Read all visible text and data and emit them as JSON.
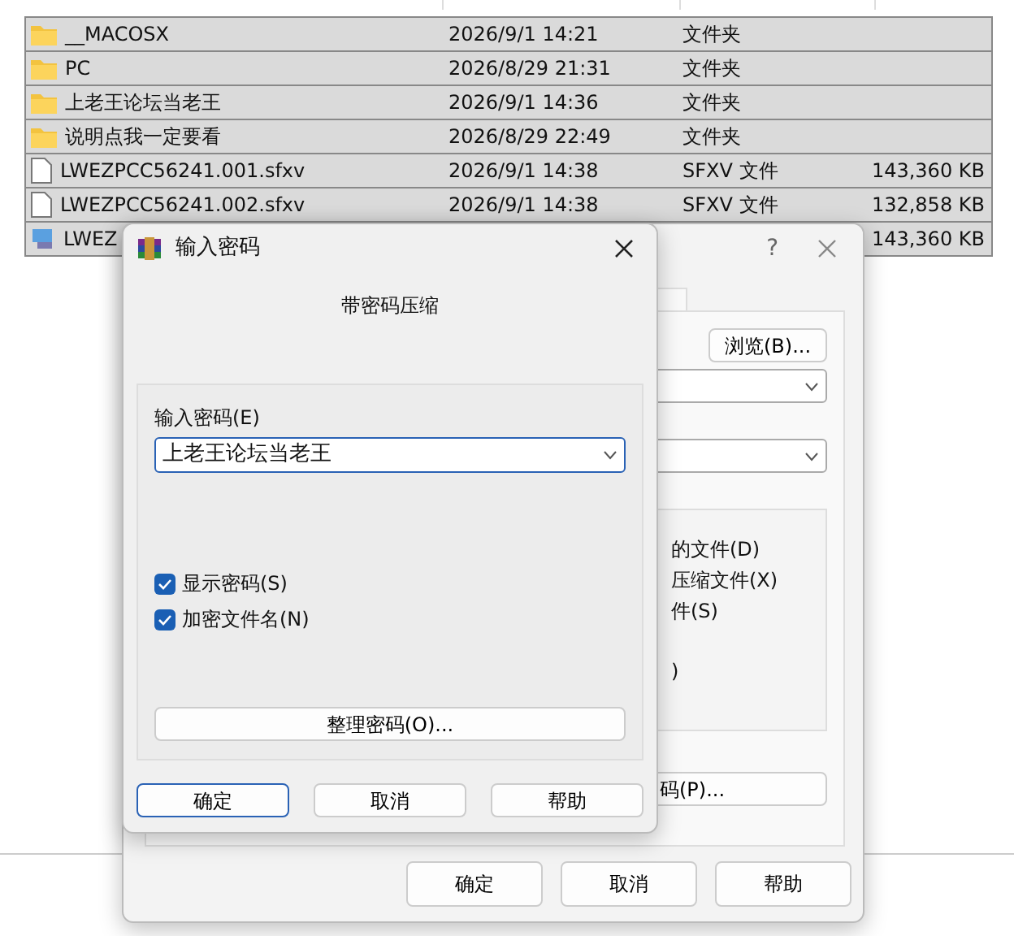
{
  "file_list": {
    "rows": [
      {
        "kind": "folder",
        "selected": true,
        "name": "__MACOSX",
        "modified": "2026/9/1 14:21",
        "type": "文件夹"
      },
      {
        "kind": "folder",
        "selected": true,
        "name": "PC",
        "modified": "2026/8/29 21:31",
        "type": "文件夹"
      },
      {
        "kind": "folder",
        "selected": true,
        "name": "上老王论坛当老王",
        "modified": "2026/9/1 14:36",
        "type": "文件夹"
      },
      {
        "kind": "folder",
        "selected": true,
        "name": "说明点我一定要看",
        "modified": "2026/8/29 22:49",
        "type": "文件夹"
      },
      {
        "kind": "file",
        "selected": true,
        "name": "LWEZPCC56241.001.sfxv",
        "modified": "2026/9/1 14:38",
        "type": "SFXV 文件",
        "size": "143,360 KB"
      },
      {
        "kind": "file",
        "selected": true,
        "name": "LWEZPCC56241.002.sfxv",
        "modified": "2026/9/1 14:38",
        "type": "SFXV 文件",
        "size": "132,858 KB"
      },
      {
        "kind": "app",
        "selected": true,
        "name": "LWEZ",
        "size": "143,360 KB"
      }
    ]
  },
  "archive_window": {
    "help_symbol": "?",
    "browse_button": "浏览(B)...",
    "options": [
      "的文件(D)",
      "压缩文件(X)",
      "件(S)",
      ")"
    ],
    "password_button": "码(P)...",
    "buttons": [
      "确定",
      "取消",
      "帮助"
    ]
  },
  "password_dialog": {
    "title": "输入密码",
    "heading": "带密码压缩",
    "password_label": "输入密码(E)",
    "password_value": "上老王论坛当老王",
    "checkboxes": [
      {
        "label": "显示密码(S)",
        "checked": true
      },
      {
        "label": "加密文件名(N)",
        "checked": true
      }
    ],
    "organize_button": "整理密码(O)...",
    "buttons": [
      {
        "label": "确定",
        "default": true
      },
      {
        "label": "取消",
        "default": false
      },
      {
        "label": "帮助",
        "default": false
      }
    ]
  }
}
